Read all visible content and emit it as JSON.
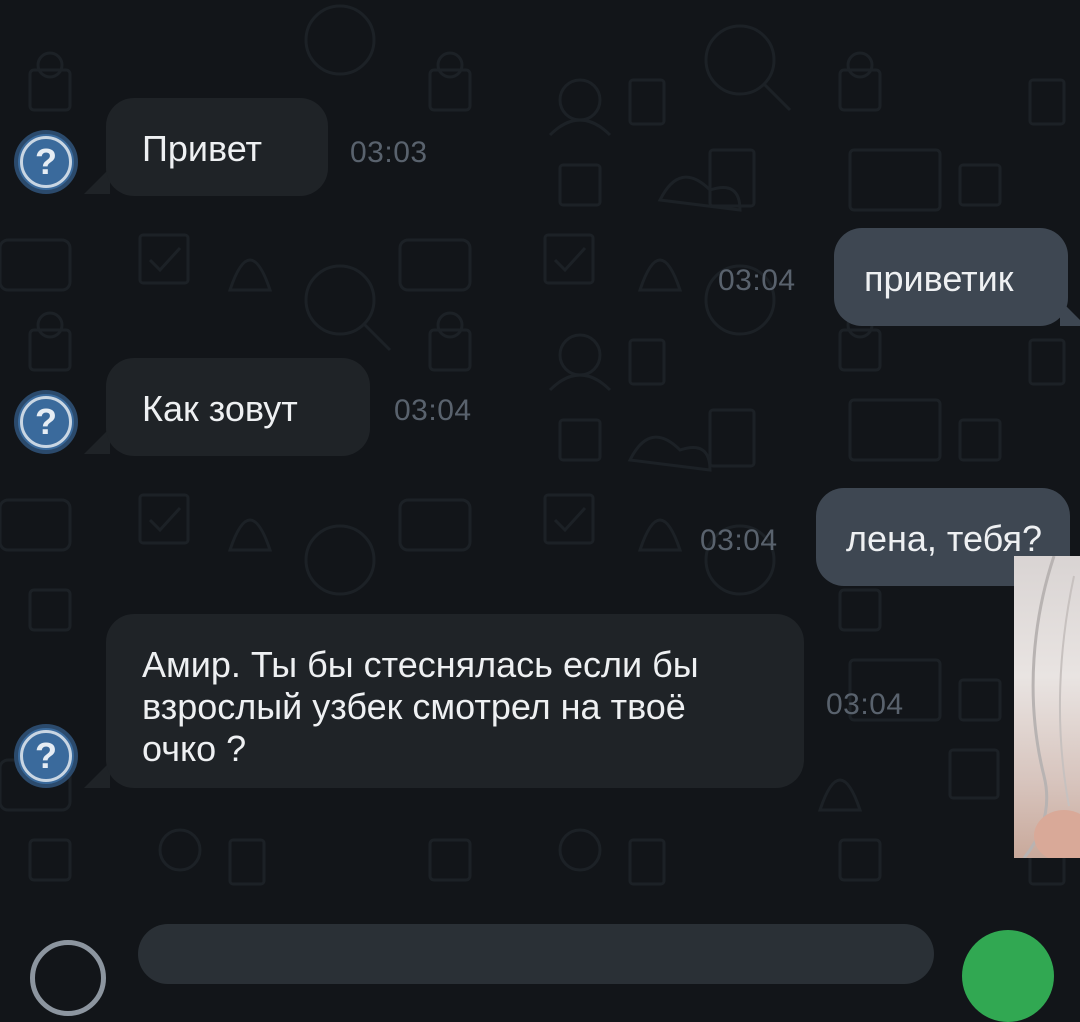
{
  "avatar_glyph": "?",
  "messages": [
    {
      "direction": "in",
      "text": "Привет",
      "time": "03:03"
    },
    {
      "direction": "out",
      "text": "приветик",
      "time": "03:04"
    },
    {
      "direction": "in",
      "text": "Как зовут",
      "time": "03:04"
    },
    {
      "direction": "out",
      "text": "лена, тебя?",
      "time": "03:04"
    },
    {
      "direction": "in",
      "text": "Амир. Ты бы стеснялась если бы\nвзрослый узбек смотрел на твоё\nочко ?",
      "time": "03:04"
    }
  ],
  "colors": {
    "background": "#121519",
    "incoming_bubble": "#1f2327",
    "outgoing_bubble": "#3e4752",
    "avatar": "#3a6a9c",
    "send_button": "#31a852"
  }
}
